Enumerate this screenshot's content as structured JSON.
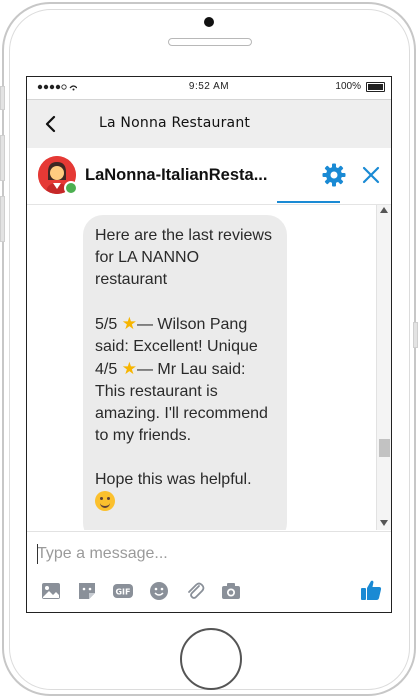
{
  "status_bar": {
    "time": "9:52 AM",
    "battery": "100%"
  },
  "nav": {
    "title": "La Nonna Restaurant"
  },
  "chat_header": {
    "bot_name": "LaNonna-ItalianResta..."
  },
  "message": {
    "intro": "Here are the last reviews for LA NANNO restaurant",
    "review1_score": "5/5",
    "review1_text": "— Wilson Pang said: Excellent! Unique",
    "review2_score": "4/5",
    "review2_text": "— Mr Lau said: This restaurant is amazing. I'll recommend to my friends.",
    "outro": "Hope this was helpful."
  },
  "composer": {
    "placeholder": "Type a message..."
  },
  "colors": {
    "accent": "#1a8ad4",
    "online": "#4caf50",
    "avatar_bg": "#e53935",
    "bubble_bg": "#ebebeb",
    "nav_bg": "#eeeeee"
  },
  "icons": [
    "back-chevron-icon",
    "gear-icon",
    "close-icon",
    "image-icon",
    "sticker-icon",
    "gif-icon",
    "emoji-icon",
    "attachment-icon",
    "camera-icon",
    "like-icon"
  ]
}
